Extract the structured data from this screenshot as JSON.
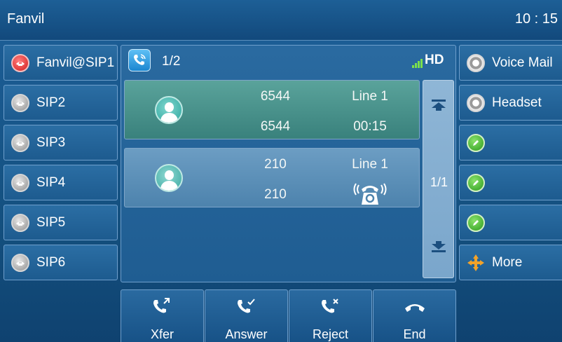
{
  "header": {
    "title": "Fanvil",
    "time": "10 : 15"
  },
  "line_keys": [
    {
      "label": "Fanvil@SIP1",
      "status": "red"
    },
    {
      "label": "SIP2",
      "status": "gray"
    },
    {
      "label": "SIP3",
      "status": "gray"
    },
    {
      "label": "SIP4",
      "status": "gray"
    },
    {
      "label": "SIP5",
      "status": "gray"
    },
    {
      "label": "SIP6",
      "status": "gray"
    }
  ],
  "dss_keys": [
    {
      "label": "Voice Mail",
      "icon": "voicemail-icon"
    },
    {
      "label": "Headset",
      "icon": "headset-icon"
    },
    {
      "label": "",
      "icon": "edit-icon"
    },
    {
      "label": "",
      "icon": "edit-icon"
    },
    {
      "label": "",
      "icon": "edit-icon"
    },
    {
      "label": "More",
      "icon": "more-arrows-icon"
    }
  ],
  "call_panel": {
    "pager": "1/2",
    "hd": "HD",
    "calls": [
      {
        "name": "6544",
        "number": "6544",
        "line": "Line 1",
        "duration": "00:15",
        "state": "active"
      },
      {
        "name": "210",
        "number": "210",
        "line": "Line 1",
        "state": "hold"
      }
    ],
    "scroll_page": "1/1"
  },
  "softkeys": [
    {
      "label": "Xfer",
      "icon": "transfer-icon"
    },
    {
      "label": "Answer",
      "icon": "answer-icon"
    },
    {
      "label": "Reject",
      "icon": "reject-icon"
    },
    {
      "label": "End",
      "icon": "hangup-icon"
    }
  ],
  "colors": {
    "background": "#12497c",
    "active_call": "#4a948c",
    "accent_green": "#7be04c"
  }
}
